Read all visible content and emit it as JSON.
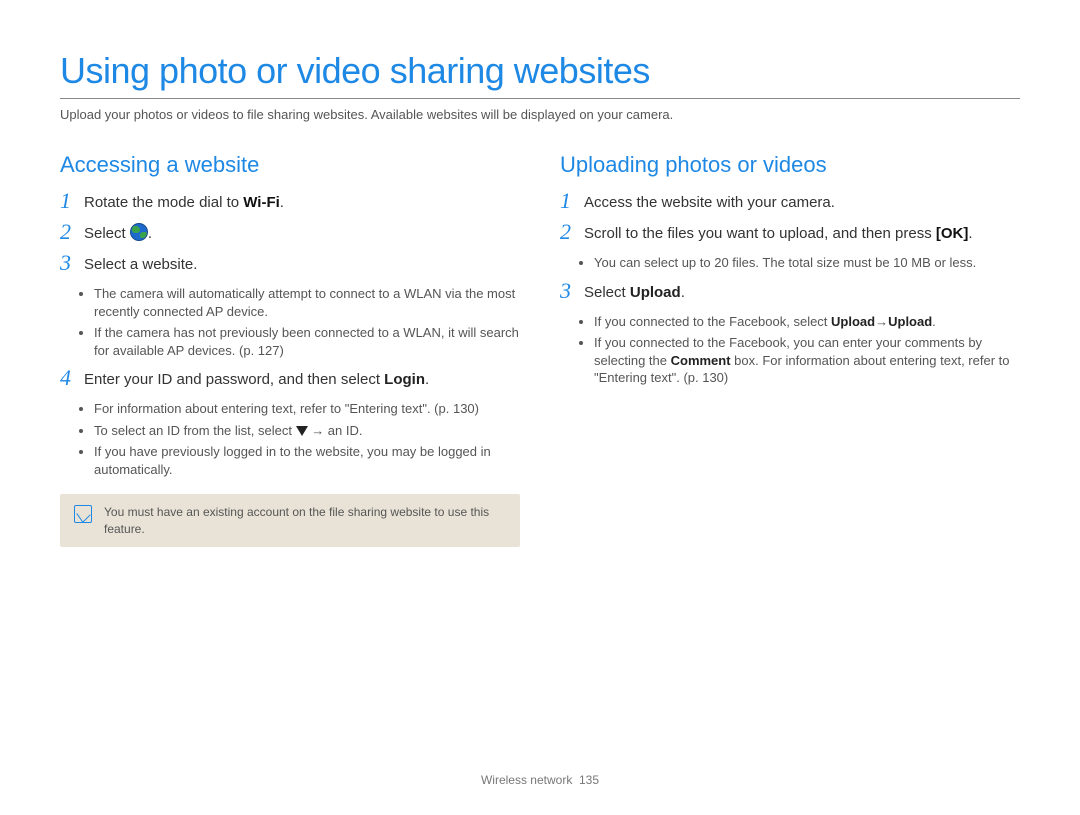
{
  "title": "Using photo or video sharing websites",
  "intro": "Upload your photos or videos to file sharing websites. Available websites will be displayed on your camera.",
  "left": {
    "heading": "Accessing a website",
    "steps": {
      "s1_pre": "Rotate the mode dial to ",
      "s1_wifi": "Wi-Fi",
      "s2_pre": "Select ",
      "s3": "Select a website.",
      "s3_b1": "The camera will automatically attempt to connect to a WLAN via the most recently connected AP device.",
      "s3_b2": "If the camera has not previously been connected to a WLAN, it will search for available AP devices. (p. 127)",
      "s4_pre": "Enter your ID and password, and then select ",
      "s4_login": "Login",
      "s4_b1": "For information about entering text, refer to \"Entering text\". (p. 130)",
      "s4_b2_pre": "To select an ID from the list, select ",
      "s4_b2_post": " → an ID.",
      "s4_b3": "If you have previously logged in to the website, you may be logged in automatically."
    },
    "note": "You must have an existing account on the file sharing website to use this feature."
  },
  "right": {
    "heading": "Uploading photos or videos",
    "steps": {
      "s1": "Access the website with your camera.",
      "s2_pre": "Scroll to the files you want to upload, and then press ",
      "s2_ok": "[OK]",
      "s2_b1": "You can select up to 20 files. The total size must be 10 MB or less.",
      "s3_pre": "Select ",
      "s3_upload": "Upload",
      "s3_b1_pre": "If you connected to the Facebook, select ",
      "s3_b1_u1": "Upload",
      "s3_b1_mid": " → ",
      "s3_b1_u2": "Upload",
      "s3_b2_pre": "If you connected to the Facebook, you can enter your comments by selecting the ",
      "s3_b2_comment": "Comment",
      "s3_b2_post": " box. For information about entering text, refer to \"Entering text\". (p. 130)"
    }
  },
  "footer": {
    "section": "Wireless network",
    "page": "135"
  }
}
